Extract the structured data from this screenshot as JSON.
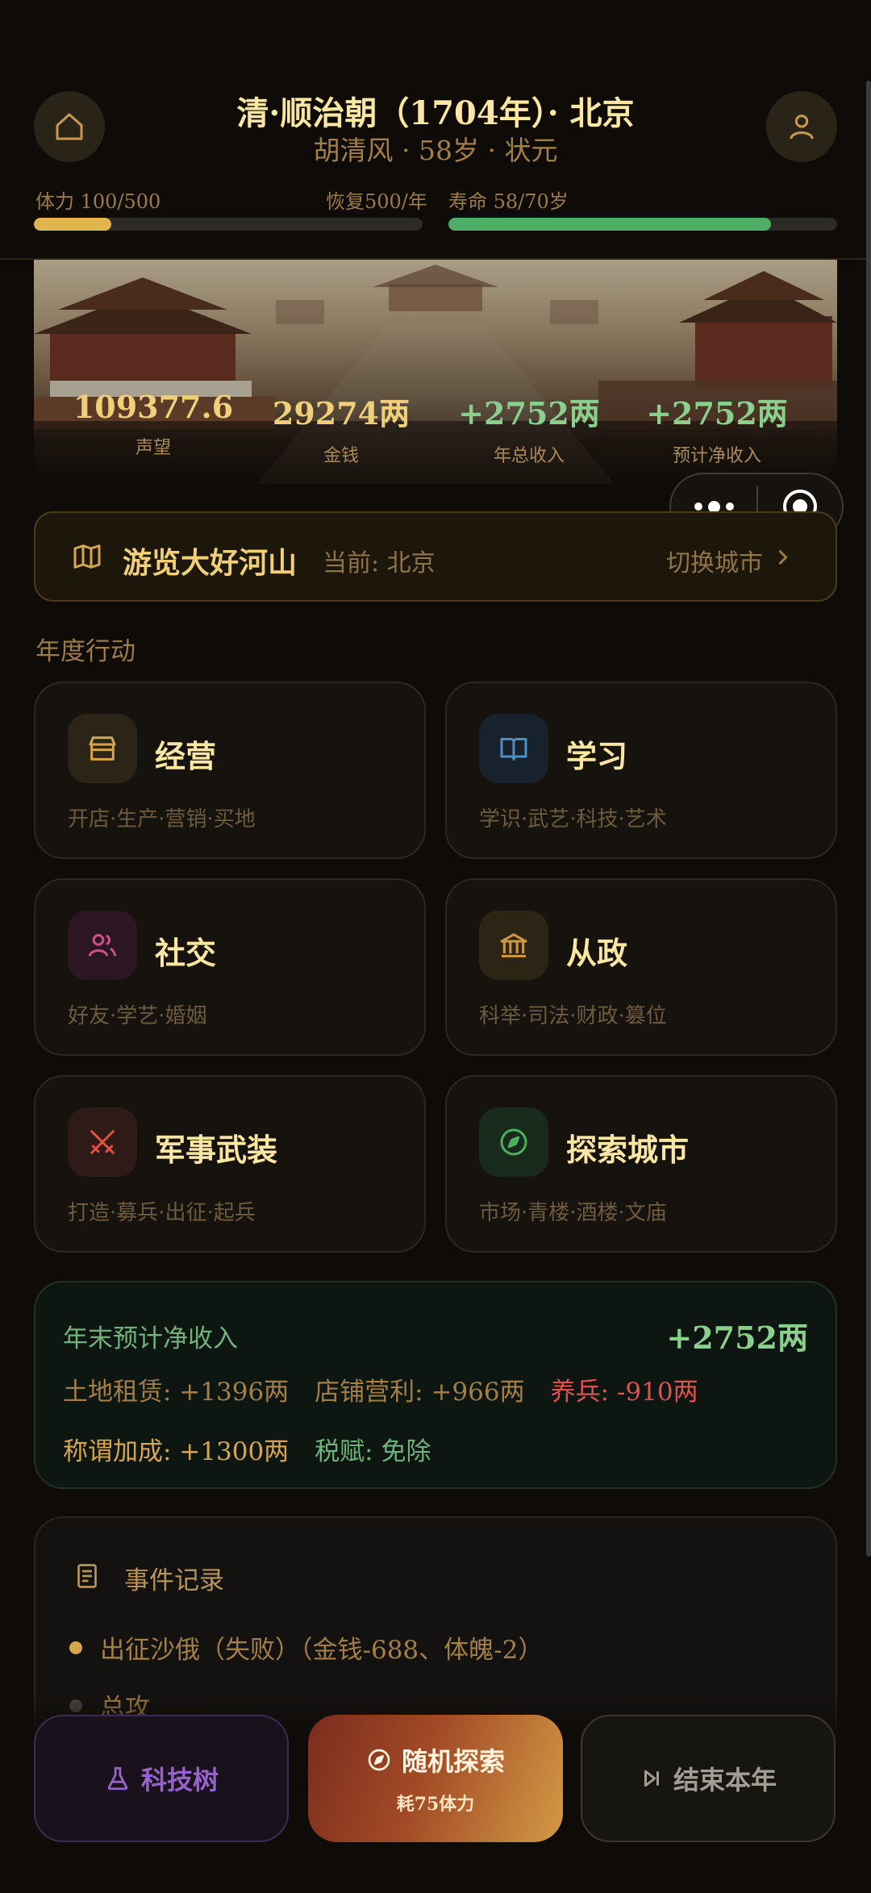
{
  "header": {
    "title": "清·顺治朝（1704年）· 北京",
    "subtitle": "胡清风 · 58岁 · 状元",
    "stamina_label": "体力 100/500",
    "stamina_recover": "恢复500/年",
    "stamina_fraction": 0.2,
    "lifespan_label": "寿命 58/70岁",
    "lifespan_fraction": 0.829
  },
  "banner": {
    "stats": [
      {
        "value": "109377.6",
        "label": "声望"
      },
      {
        "value": "29274两",
        "label": "金钱"
      },
      {
        "value": "+2752两",
        "label": "年总收入"
      },
      {
        "value": "+2752两",
        "label": "预计净收入"
      }
    ]
  },
  "travel": {
    "title": "游览大好河山",
    "current": "当前: 北京",
    "switch": "切换城市"
  },
  "section_title": "年度行动",
  "actions": [
    {
      "title": "经营",
      "subtitle": "开店·生产·营销·买地",
      "icon": "shop-icon",
      "color": "#d6a64e",
      "bg": "#2c2416"
    },
    {
      "title": "学习",
      "subtitle": "学识·武艺·科技·艺术",
      "icon": "book-icon",
      "color": "#4e8fc8",
      "bg": "#18222c"
    },
    {
      "title": "社交",
      "subtitle": "好友·学艺·婚姻",
      "icon": "users-icon",
      "color": "#d0508c",
      "bg": "#2c1622"
    },
    {
      "title": "从政",
      "subtitle": "科举·司法·财政·篡位",
      "icon": "government-icon",
      "color": "#d09a3e",
      "bg": "#2c2414"
    },
    {
      "title": "军事武装",
      "subtitle": "打造·募兵·出征·起兵",
      "icon": "swords-icon",
      "color": "#e0503e",
      "bg": "#2e1a16"
    },
    {
      "title": "探索城市",
      "subtitle": "市场·青楼·酒楼·文庙",
      "icon": "compass-icon",
      "color": "#4caf5e",
      "bg": "#172a1c"
    }
  ],
  "income": {
    "title": "年末预计净收入",
    "total": "+2752两",
    "row1": [
      "土地租赁: +1396两",
      "店铺营利: +966两",
      "养兵: -910两"
    ],
    "row2": [
      "称谓加成: +1300两",
      "税赋: 免除"
    ]
  },
  "events": {
    "title": "事件记录",
    "items": [
      "出征沙俄（失败）（金钱-688、体魄-2）",
      "总攻"
    ]
  },
  "bottom": {
    "tech": "科技树",
    "explore": "随机探索",
    "explore_cost": "耗75体力",
    "end_year": "结束本年"
  },
  "colors": {
    "gold": "#e9c97c",
    "stamina_bar": "#e1b44e",
    "lifespan_bar": "#4eae68",
    "positive": "#8ad08d",
    "negative": "#e05050"
  }
}
